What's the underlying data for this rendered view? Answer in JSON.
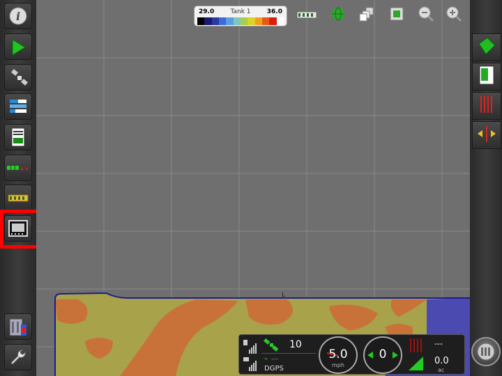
{
  "legend": {
    "min_value": "29.0",
    "title": "Tank 1",
    "max_value": "36.0",
    "colors": [
      "#000000",
      "#1a1a6e",
      "#2a3aa0",
      "#3b6bd8",
      "#5aa0e0",
      "#7fc6c0",
      "#a7cf48",
      "#e0d02a",
      "#f0a020",
      "#e85a14",
      "#d81e0e",
      "#ffffff"
    ]
  },
  "status": {
    "satellite_count": "10",
    "correction_value": "---",
    "gps_mode": "DGPS",
    "speed": "5.0",
    "speed_unit": "mph",
    "cross_track": "0",
    "rate": "---",
    "area": "0.0",
    "area_unit": "ac"
  },
  "colors": {
    "map_background": "#6f6f6f",
    "coverage_orange": "#c8723a",
    "coverage_olive": "#a8a24a",
    "coverage_blue": "#4a4ab0",
    "boundary": "#1c1c8c",
    "highlight": "#ff0000"
  }
}
